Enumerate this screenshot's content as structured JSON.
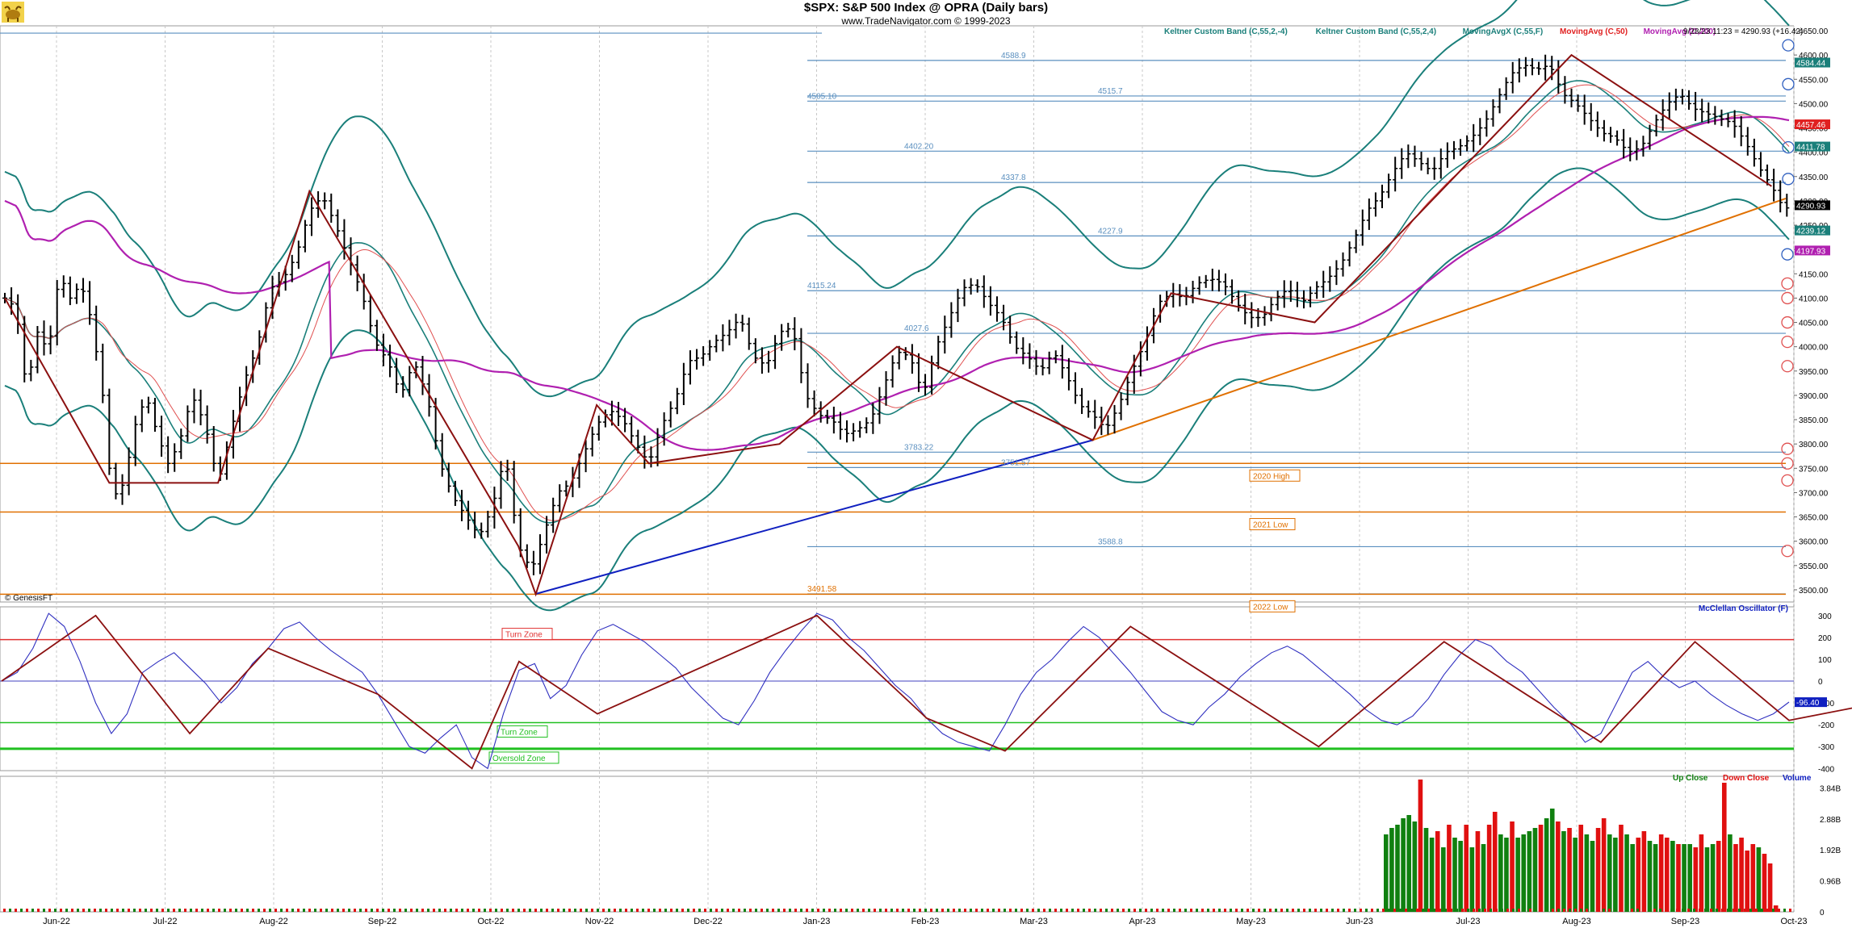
{
  "header": {
    "title": "$SPX:  S&P 500 Index @ OPRA  (Daily bars)",
    "subtitle": "www.TradeNavigator.com © 1999-2023",
    "timestamp": "9/28/23 11:23 = 4290.93 (+16.42)",
    "watermark": "© GenesisFT"
  },
  "legend": [
    {
      "label": "Keltner Custom Band (C,55,2,-4)",
      "color": "#1a7f7a"
    },
    {
      "label": "Keltner Custom Band (C,55,2,4)",
      "color": "#1a7f7a"
    },
    {
      "label": "MovingAvgX (C,55,F)",
      "color": "#1a7f7a"
    },
    {
      "label": "MovingAvg (C,50)",
      "color": "#e02020"
    },
    {
      "label": "MovingAvg (C,200)",
      "color": "#b020b0"
    }
  ],
  "colors": {
    "bars": "#000000",
    "keltner": "#1a7f7a",
    "ma50": "#e05050",
    "ma200": "#b020b0",
    "zigzag": "#8b1010",
    "support": "#5a8fbf",
    "orange": "#e07000",
    "uptrend": "#1020c0",
    "oscillator": "#3030c0",
    "turn_zone": "#e03030",
    "oversold": "#20c020",
    "up_close": "#108010",
    "down_close": "#e01010",
    "grid": "#c8c8c8"
  },
  "chart_data": [
    {
      "type": "ohlc",
      "panel": "price",
      "ylim": [
        3475,
        4660
      ],
      "yticks": [
        "4650.00",
        "4600.00",
        "4550.00",
        "4500.00",
        "4450.00",
        "4400.00",
        "4350.00",
        "4300.00",
        "4250.00",
        "4200.00",
        "4150.00",
        "4100.00",
        "4050.00",
        "4000.00",
        "3950.00",
        "3900.00",
        "3850.00",
        "3800.00",
        "3750.00",
        "3700.00",
        "3650.00",
        "3600.00",
        "3550.00",
        "3500.00"
      ],
      "x_labels": [
        "Jun-22",
        "Jul-22",
        "Aug-22",
        "Sep-22",
        "Oct-22",
        "Nov-22",
        "Dec-22",
        "Jan-23",
        "Feb-23",
        "Mar-23",
        "Apr-23",
        "May-23",
        "Jun-23",
        "Jul-23",
        "Aug-23",
        "Sep-23",
        "Oct-23"
      ],
      "close_path": [
        [
          0,
          4100
        ],
        [
          5,
          4080
        ],
        [
          10,
          3910
        ],
        [
          15,
          4030
        ],
        [
          20,
          3990
        ],
        [
          25,
          4150
        ],
        [
          30,
          4100
        ],
        [
          35,
          4130
        ],
        [
          40,
          4050
        ],
        [
          45,
          3900
        ],
        [
          48,
          3750
        ],
        [
          52,
          3680
        ],
        [
          56,
          3750
        ],
        [
          60,
          3840
        ],
        [
          65,
          3900
        ],
        [
          70,
          3820
        ],
        [
          75,
          3760
        ],
        [
          80,
          3800
        ],
        [
          86,
          3900
        ],
        [
          92,
          3840
        ],
        [
          98,
          3720
        ],
        [
          104,
          3830
        ],
        [
          110,
          3930
        ],
        [
          116,
          4000
        ],
        [
          122,
          4120
        ],
        [
          128,
          4140
        ],
        [
          134,
          4190
        ],
        [
          140,
          4280
        ],
        [
          146,
          4310
        ],
        [
          152,
          4250
        ],
        [
          158,
          4180
        ],
        [
          164,
          4110
        ],
        [
          170,
          4010
        ],
        [
          176,
          3970
        ],
        [
          182,
          3900
        ],
        [
          188,
          3970
        ],
        [
          194,
          3900
        ],
        [
          200,
          3760
        ],
        [
          206,
          3690
        ],
        [
          212,
          3650
        ],
        [
          218,
          3610
        ],
        [
          224,
          3670
        ],
        [
          230,
          3780
        ],
        [
          236,
          3590
        ],
        [
          242,
          3540
        ],
        [
          248,
          3620
        ],
        [
          254,
          3700
        ],
        [
          260,
          3720
        ],
        [
          266,
          3780
        ],
        [
          272,
          3840
        ],
        [
          278,
          3870
        ],
        [
          284,
          3850
        ],
        [
          290,
          3800
        ],
        [
          296,
          3760
        ],
        [
          302,
          3840
        ],
        [
          308,
          3890
        ],
        [
          314,
          3970
        ],
        [
          320,
          3980
        ],
        [
          326,
          4010
        ],
        [
          332,
          4030
        ],
        [
          338,
          4060
        ],
        [
          344,
          3980
        ],
        [
          350,
          3960
        ],
        [
          356,
          4030
        ],
        [
          362,
          4040
        ],
        [
          368,
          3900
        ],
        [
          374,
          3860
        ],
        [
          380,
          3850
        ],
        [
          386,
          3820
        ],
        [
          392,
          3830
        ],
        [
          398,
          3850
        ],
        [
          404,
          3920
        ],
        [
          410,
          3990
        ],
        [
          416,
          3980
        ],
        [
          422,
          3900
        ],
        [
          428,
          4000
        ],
        [
          434,
          4060
        ],
        [
          440,
          4120
        ],
        [
          446,
          4130
        ],
        [
          452,
          4090
        ],
        [
          458,
          4060
        ],
        [
          464,
          4000
        ],
        [
          470,
          3980
        ],
        [
          476,
          3950
        ],
        [
          482,
          3990
        ],
        [
          488,
          3940
        ],
        [
          494,
          3880
        ],
        [
          500,
          3860
        ],
        [
          506,
          3830
        ],
        [
          512,
          3880
        ],
        [
          518,
          3950
        ],
        [
          524,
          4010
        ],
        [
          530,
          4090
        ],
        [
          536,
          4110
        ],
        [
          542,
          4100
        ],
        [
          548,
          4130
        ],
        [
          554,
          4140
        ],
        [
          560,
          4130
        ],
        [
          566,
          4090
        ],
        [
          572,
          4060
        ],
        [
          578,
          4060
        ],
        [
          584,
          4100
        ],
        [
          590,
          4120
        ],
        [
          596,
          4090
        ],
        [
          602,
          4120
        ],
        [
          608,
          4140
        ],
        [
          614,
          4170
        ],
        [
          620,
          4220
        ],
        [
          626,
          4280
        ],
        [
          632,
          4310
        ],
        [
          638,
          4360
        ],
        [
          644,
          4400
        ],
        [
          650,
          4380
        ],
        [
          656,
          4360
        ],
        [
          662,
          4400
        ],
        [
          668,
          4410
        ],
        [
          674,
          4430
        ],
        [
          680,
          4460
        ],
        [
          686,
          4510
        ],
        [
          692,
          4560
        ],
        [
          698,
          4580
        ],
        [
          704,
          4570
        ],
        [
          710,
          4580
        ],
        [
          716,
          4520
        ],
        [
          722,
          4500
        ],
        [
          728,
          4470
        ],
        [
          734,
          4440
        ],
        [
          740,
          4430
        ],
        [
          746,
          4400
        ],
        [
          752,
          4410
        ],
        [
          758,
          4460
        ],
        [
          764,
          4500
        ],
        [
          770,
          4520
        ],
        [
          776,
          4490
        ],
        [
          782,
          4480
        ],
        [
          788,
          4470
        ],
        [
          794,
          4460
        ],
        [
          800,
          4420
        ],
        [
          806,
          4370
        ],
        [
          812,
          4330
        ],
        [
          818,
          4280
        ],
        [
          820,
          4291
        ]
      ],
      "last_value": 4290.93,
      "change": 16.42,
      "right_axis_tags": [
        {
          "label": "4584.44",
          "value": 4584.44,
          "color": "#1a7f7a"
        },
        {
          "label": "4457.46",
          "value": 4457.46,
          "color": "#e02020"
        },
        {
          "label": "4411.78",
          "value": 4411.78,
          "color": "#1a7f7a"
        },
        {
          "label": "4290.93",
          "value": 4290.93,
          "color": "#000000"
        },
        {
          "label": "4239.12",
          "value": 4239.12,
          "color": "#1a7f7a"
        },
        {
          "label": "4197.93",
          "value": 4197.93,
          "color": "#b020b0"
        }
      ],
      "level_labels": [
        {
          "text": "3491.58",
          "value": 3491.58
        },
        {
          "text": "3783.22",
          "value": 3783.22
        },
        {
          "text": "4588.9",
          "value": 4588.9
        },
        {
          "text": "4515.7",
          "value": 4515.7
        },
        {
          "text": "4505.10",
          "value": 4505.1
        },
        {
          "text": "4402.20",
          "value": 4402.2
        },
        {
          "text": "4337.8",
          "value": 4337.8
        },
        {
          "text": "4227.9",
          "value": 4227.9
        },
        {
          "text": "4115.24",
          "value": 4115.24
        },
        {
          "text": "4027.6",
          "value": 4027.6
        },
        {
          "text": "3751.57",
          "value": 3751.57
        },
        {
          "text": "3588.8",
          "value": 3588.8
        }
      ],
      "annotations": [
        {
          "text": "2020 High",
          "value": 3760
        },
        {
          "text": "2021 Low",
          "value": 3660
        },
        {
          "text": "2022 Low",
          "value": 3491
        }
      ]
    },
    {
      "type": "line",
      "panel": "oscillator",
      "title": "McClellan Oscillator (F)",
      "ylim": [
        -410,
        340
      ],
      "yticks": [
        "300",
        "200",
        "100",
        "0",
        "-100",
        "-200",
        "-300",
        "-400"
      ],
      "last_value": -96.4,
      "last_label": "-96.40",
      "zones": [
        {
          "text": "Turn Zone",
          "value": 190
        },
        {
          "text": "Turn Zone",
          "value": -190
        },
        {
          "text": "Oversold Zone",
          "value": -310
        }
      ],
      "values": [
        0,
        40,
        150,
        310,
        250,
        90,
        -100,
        -240,
        -150,
        40,
        90,
        130,
        60,
        -10,
        -100,
        -30,
        80,
        150,
        240,
        270,
        200,
        140,
        90,
        40,
        -60,
        -180,
        -300,
        -330,
        -260,
        -200,
        -350,
        -400,
        -150,
        50,
        80,
        -80,
        -20,
        120,
        230,
        260,
        220,
        180,
        120,
        60,
        -30,
        -100,
        -170,
        -200,
        -90,
        40,
        140,
        230,
        310,
        280,
        200,
        140,
        60,
        -20,
        -80,
        -170,
        -240,
        -280,
        -300,
        -320,
        -200,
        -60,
        40,
        100,
        180,
        250,
        200,
        120,
        40,
        -50,
        -140,
        -180,
        -200,
        -120,
        -60,
        20,
        80,
        130,
        160,
        120,
        60,
        0,
        -60,
        -130,
        -180,
        -200,
        -160,
        -80,
        30,
        120,
        190,
        160,
        90,
        40,
        -40,
        -120,
        -190,
        -280,
        -240,
        -100,
        40,
        90,
        20,
        -30,
        0,
        -60,
        -110,
        -150,
        -180,
        -150,
        -96
      ]
    },
    {
      "type": "bar",
      "panel": "volume",
      "legend": [
        "Up Close",
        "Down Close",
        "Volume"
      ],
      "ylim": [
        0,
        4.1
      ],
      "yticks": [
        "3.84B",
        "2.88B",
        "1.92B",
        "0.96B",
        "0"
      ],
      "values": [
        2.4,
        2.6,
        2.7,
        2.9,
        3.0,
        2.8,
        4.1,
        2.6,
        2.3,
        2.5,
        2.0,
        2.7,
        2.3,
        2.2,
        2.7,
        2.0,
        2.5,
        2.1,
        2.7,
        3.1,
        2.4,
        2.3,
        2.8,
        2.3,
        2.4,
        2.5,
        2.6,
        2.7,
        2.9,
        3.2,
        2.8,
        2.5,
        2.6,
        2.3,
        2.7,
        2.4,
        2.2,
        2.6,
        2.9,
        2.4,
        2.3,
        2.7,
        2.4,
        2.1,
        2.3,
        2.5,
        2.2,
        2.1,
        2.4,
        2.3,
        2.2,
        2.1,
        2.1,
        2.1,
        2.0,
        2.4,
        2.0,
        2.1,
        2.2,
        4.0,
        2.4,
        2.1,
        2.3,
        1.9,
        2.1,
        2.0,
        1.8,
        1.5,
        0.2
      ],
      "up": [
        1,
        1,
        1,
        1,
        1,
        1,
        0,
        1,
        1,
        0,
        1,
        0,
        1,
        1,
        0,
        1,
        0,
        1,
        0,
        0,
        1,
        1,
        0,
        1,
        1,
        1,
        1,
        0,
        1,
        1,
        0,
        1,
        0,
        1,
        0,
        1,
        1,
        0,
        0,
        1,
        1,
        0,
        1,
        1,
        0,
        0,
        1,
        1,
        0,
        0,
        1,
        0,
        1,
        1,
        0,
        0,
        1,
        1,
        0,
        0,
        1,
        0,
        0,
        0,
        0,
        1,
        0,
        0,
        0
      ]
    }
  ]
}
